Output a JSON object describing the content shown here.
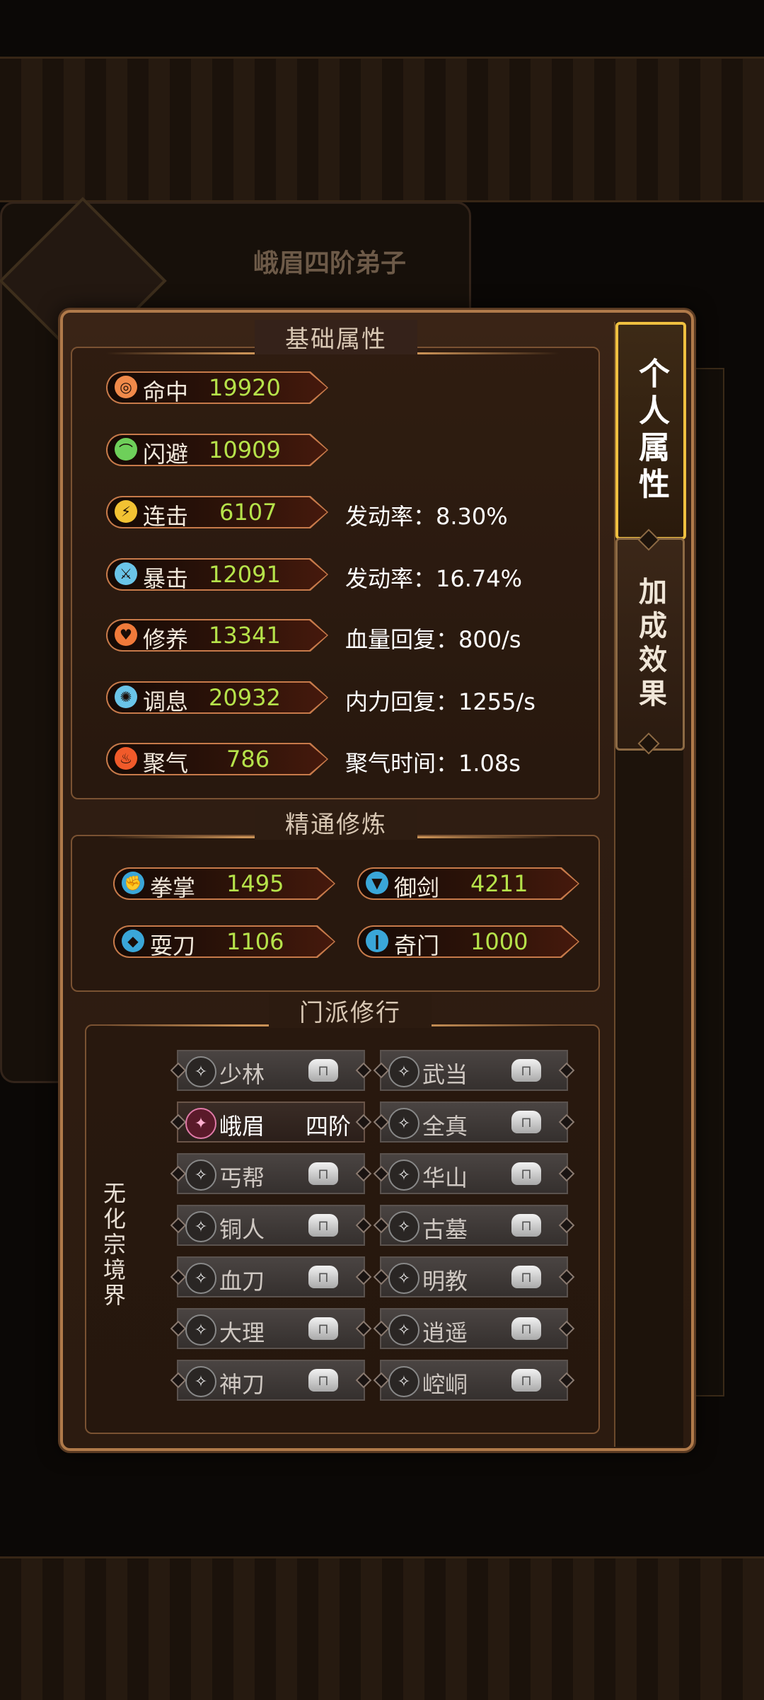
{
  "background": {
    "card_title": "峨眉四阶弟子"
  },
  "tabs": {
    "active": "个人属性",
    "inactive": "加成效果"
  },
  "sections": {
    "basic": "基础属性",
    "mastery": "精通修炼",
    "sect": "门派修行"
  },
  "basic_stats": [
    {
      "label": "命中",
      "value": "19920",
      "extra": "",
      "icon": "target-icon",
      "color": "#f08a4a"
    },
    {
      "label": "闪避",
      "value": "10909",
      "extra": "",
      "icon": "boot-icon",
      "color": "#6ecf5a"
    },
    {
      "label": "连击",
      "value": "6107",
      "extra": "发动率：8.30%",
      "icon": "lightning-icon",
      "color": "#f2c233"
    },
    {
      "label": "暴击",
      "value": "12091",
      "extra": "发动率：16.74%",
      "icon": "sword-icon",
      "color": "#6ac4e8"
    },
    {
      "label": "修养",
      "value": "13341",
      "extra": "血量回复：800/s",
      "icon": "heart-icon",
      "color": "#f07a3a"
    },
    {
      "label": "调息",
      "value": "20932",
      "extra": "内力回复：1255/s",
      "icon": "swirl-icon",
      "color": "#6ac4e8"
    },
    {
      "label": "聚气",
      "value": "786",
      "extra": "聚气时间：1.08s",
      "icon": "flame-icon",
      "color": "#f05a2a"
    }
  ],
  "mastery_stats": [
    {
      "label": "拳掌",
      "value": "1495",
      "icon": "fist-icon"
    },
    {
      "label": "御剑",
      "value": "4211",
      "icon": "sword-drop-icon"
    },
    {
      "label": "耍刀",
      "value": "1106",
      "icon": "blade-icon"
    },
    {
      "label": "奇门",
      "value": "1000",
      "icon": "rune-icon"
    }
  ],
  "sects": [
    {
      "name": "少林",
      "rank": "",
      "learned": false,
      "icon": "shaolin-icon"
    },
    {
      "name": "武当",
      "rank": "",
      "learned": false,
      "icon": "wudang-icon"
    },
    {
      "name": "峨眉",
      "rank": "四阶",
      "learned": true,
      "icon": "emei-icon"
    },
    {
      "name": "全真",
      "rank": "",
      "learned": false,
      "icon": "quanzhen-icon"
    },
    {
      "name": "丐帮",
      "rank": "",
      "learned": false,
      "icon": "gaibang-icon"
    },
    {
      "name": "华山",
      "rank": "",
      "learned": false,
      "icon": "huashan-icon"
    },
    {
      "name": "铜人",
      "rank": "",
      "learned": false,
      "icon": "tongren-icon"
    },
    {
      "name": "古墓",
      "rank": "",
      "learned": false,
      "icon": "gumu-icon"
    },
    {
      "name": "血刀",
      "rank": "",
      "learned": false,
      "icon": "xuedao-icon"
    },
    {
      "name": "明教",
      "rank": "",
      "learned": false,
      "icon": "mingjiao-icon"
    },
    {
      "name": "大理",
      "rank": "",
      "learned": false,
      "icon": "dali-icon"
    },
    {
      "name": "逍遥",
      "rank": "",
      "learned": false,
      "icon": "xiaoyao-icon"
    },
    {
      "name": "神刀",
      "rank": "",
      "learned": false,
      "icon": "shendao-icon"
    },
    {
      "name": "崆峒",
      "rank": "",
      "learned": false,
      "icon": "kongtong-icon"
    }
  ],
  "realm_label": "无化宗境界"
}
